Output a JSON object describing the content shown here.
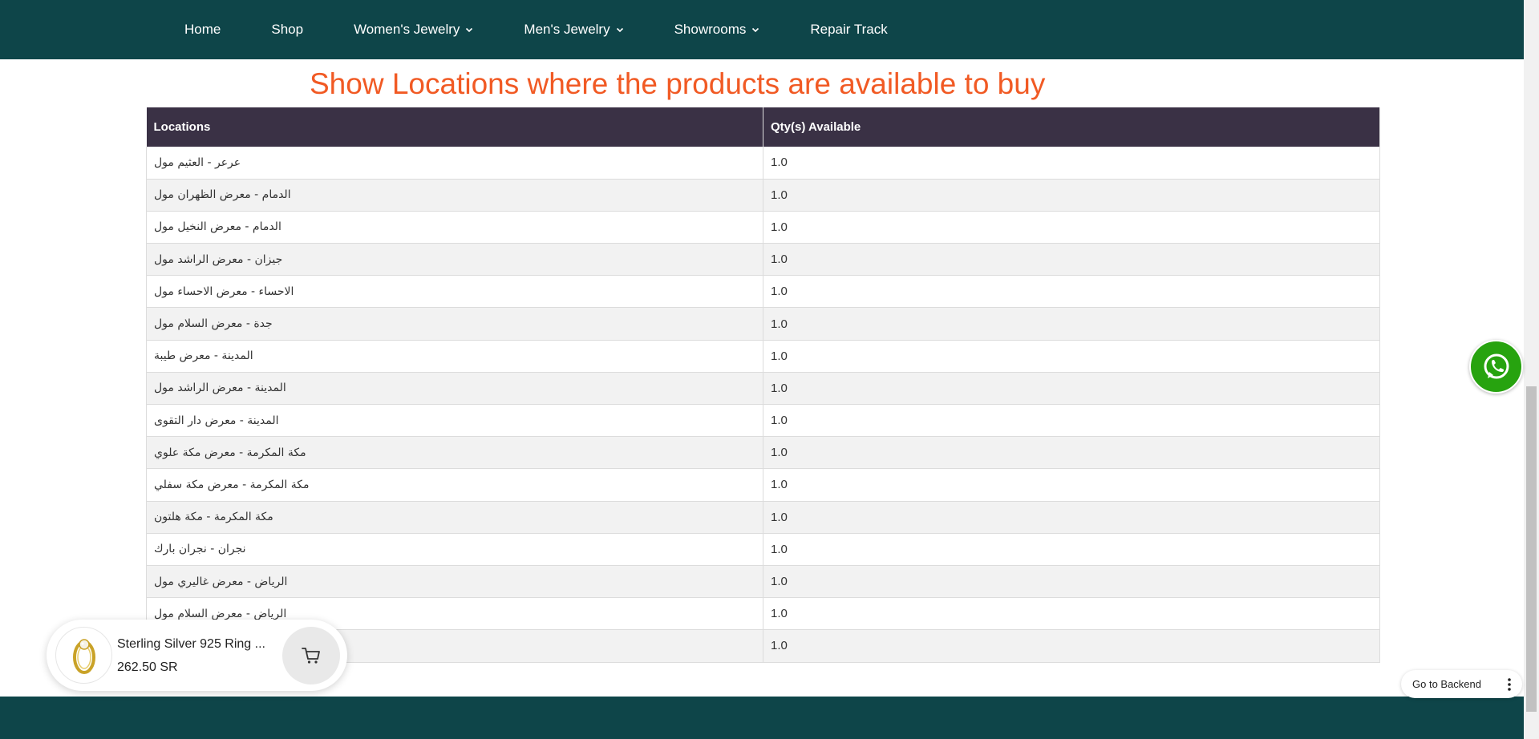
{
  "nav": {
    "items": [
      {
        "label": "Home",
        "has_dropdown": false
      },
      {
        "label": "Shop",
        "has_dropdown": false
      },
      {
        "label": "Women's Jewelry",
        "has_dropdown": true
      },
      {
        "label": "Men's Jewelry",
        "has_dropdown": true
      },
      {
        "label": "Showrooms",
        "has_dropdown": true
      },
      {
        "label": "Repair Track",
        "has_dropdown": false
      }
    ]
  },
  "heading": "Show Locations where the products are available to buy",
  "table": {
    "headers": [
      "Locations",
      "Qty(s) Available"
    ],
    "rows": [
      {
        "location": "عرعر - العثيم مول",
        "qty": "1.0"
      },
      {
        "location": "الدمام - معرض الظهران مول",
        "qty": "1.0"
      },
      {
        "location": "الدمام - معرض النخيل مول",
        "qty": "1.0"
      },
      {
        "location": "جيزان - معرض الراشد مول",
        "qty": "1.0"
      },
      {
        "location": "الاحساء - معرض الاحساء مول",
        "qty": "1.0"
      },
      {
        "location": "جدة - معرض السلام مول",
        "qty": "1.0"
      },
      {
        "location": "المدينة - معرض طيبة",
        "qty": "1.0"
      },
      {
        "location": "المدينة - معرض الراشد مول",
        "qty": "1.0"
      },
      {
        "location": "المدينة - معرض دار التقوى",
        "qty": "1.0"
      },
      {
        "location": "مكة المكرمة - معرض مكة علوي",
        "qty": "1.0"
      },
      {
        "location": "مكة المكرمة - معرض مكة سفلي",
        "qty": "1.0"
      },
      {
        "location": "مكة المكرمة - مكة هلتون",
        "qty": "1.0"
      },
      {
        "location": "نجران - نجران بارك",
        "qty": "1.0"
      },
      {
        "location": "الرياض - معرض غاليري مول",
        "qty": "1.0"
      },
      {
        "location": "الرياض - معرض السلام مول",
        "qty": "1.0"
      },
      {
        "location": "",
        "qty": "1.0"
      }
    ]
  },
  "cart_popup": {
    "product_name": "Sterling Silver 925 Ring ...",
    "price": "262.50 SR"
  },
  "backend": {
    "label": "Go to Backend"
  },
  "colors": {
    "nav_bg": "#0e4549",
    "heading": "#f15a24",
    "table_header_bg": "#3a3145",
    "whatsapp": "#27a30f"
  },
  "icons": {
    "whatsapp": "whatsapp-icon",
    "cart": "cart-icon",
    "chevron": "chevron-down-icon",
    "kebab": "kebab-menu-icon",
    "product": "ring-thumbnail"
  }
}
